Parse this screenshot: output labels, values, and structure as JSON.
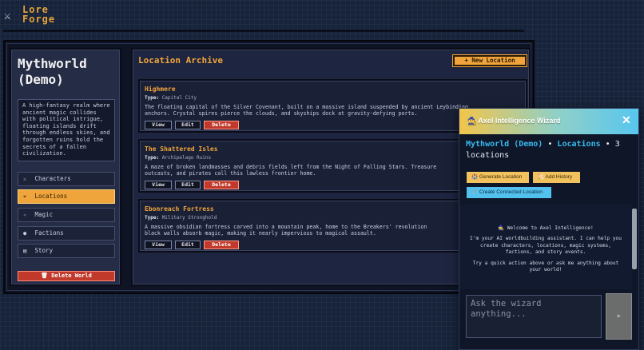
{
  "app": {
    "logo_icon": "⚔",
    "logo_line1": "Lore",
    "logo_line2": "Forge",
    "logo_icon_name": "crossed-swords-icon"
  },
  "sidebar": {
    "world_title": "Mythworld (Demo)",
    "world_description": "A high-fantasy realm where ancient magic collides with political intrigue, floating islands drift through endless skies, and forgotten ruins hold the secrets of a fallen civilization.",
    "items": [
      {
        "icon": "⚔",
        "label": "Characters"
      },
      {
        "icon": "⌖",
        "label": "Locations"
      },
      {
        "icon": "✧",
        "label": "Magic"
      },
      {
        "icon": "●",
        "label": "Factions"
      },
      {
        "icon": "▤",
        "label": "Story"
      }
    ],
    "active_item": "Locations",
    "delete_world_label": "🗑 Delete World"
  },
  "main": {
    "title": "Location Archive",
    "new_button_label": "+ New Location",
    "type_label": "Type:",
    "locations": [
      {
        "name": "Highmere",
        "type": "Capital City",
        "description_lines": [
          "The floating capital of the Silver Covenant, built on a massive island suspended by ancient Leybinding",
          "anchors. Crystal spires pierce the clouds, and skyships dock at gravity-defying ports."
        ]
      },
      {
        "name": "The Shattered Isles",
        "type": "Archipelago Ruins",
        "description_lines": [
          "A maze of broken landmasses and debris fields left from the Night of Falling Stars. Treasure",
          "outcasts, and pirates call this lawless frontier home."
        ]
      },
      {
        "name": "Ebonreach Fortress",
        "type": "Military Stronghold",
        "description_lines": [
          "A massive obsidian fortress carved into a mountain peak, home to the Breakers' revolution",
          "black walls absorb magic, making it nearly impervious to magical assault."
        ]
      }
    ],
    "view_label": "View",
    "edit_label": "Edit",
    "delete_label": "Delete"
  },
  "wizard": {
    "title": "🧙 Axel Intelligence Wizard",
    "close_label": "✕",
    "context_world": "Mythworld (Demo)",
    "context_sep1": "•",
    "context_section": "Locations",
    "context_sep2": "•",
    "context_count": "3 locations",
    "quick_actions": [
      "🏰 Generate Location",
      "📜 Add History",
      "🔗 Create Connected Location"
    ],
    "welcome": "🧙 Welcome to Axel Intelligence!",
    "intro": "I'm your AI worldbuilding assistant. I can help you create characters, locations, magic systems, factions, and story events.",
    "prompt": "Try a quick action above or ask me anything about your world!",
    "input_placeholder": "Ask the wizard anything...",
    "send_label": "➤"
  },
  "colors": {
    "accent": "#f0a53c",
    "danger": "#c0392b",
    "link": "#38b9f0"
  }
}
